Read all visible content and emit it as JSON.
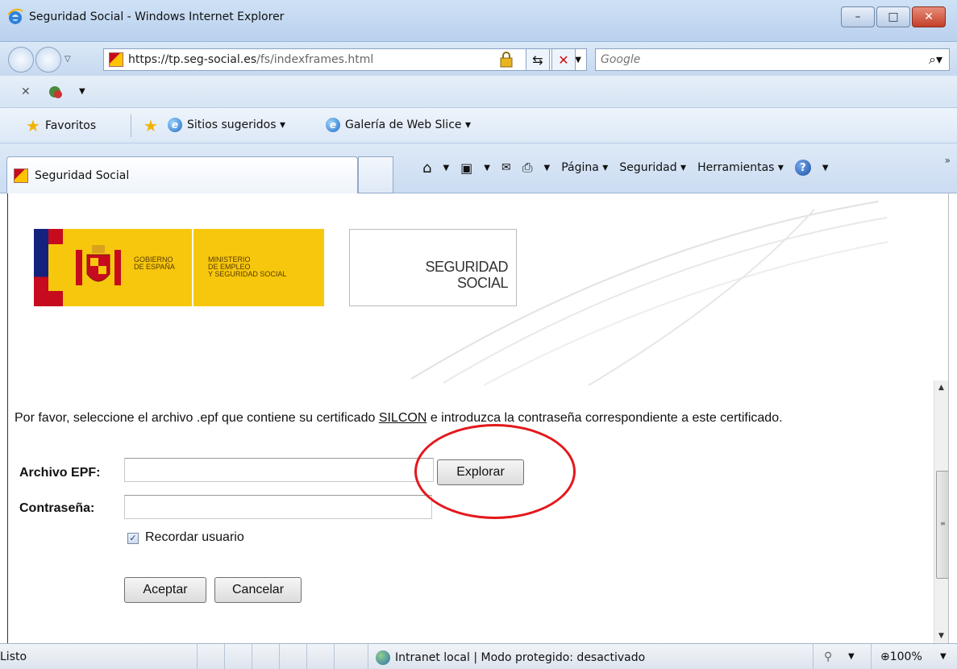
{
  "window": {
    "title": "Seguridad Social - Windows Internet Explorer",
    "minimize_glyph": "–",
    "maximize_glyph": "□",
    "close_glyph": "✕"
  },
  "address": {
    "url_host": "https://tp.seg-social.es",
    "url_path": "/fs/indexframes.html",
    "search_placeholder": "Google"
  },
  "favorites_bar": {
    "favorites_label": "Favoritos",
    "suggested_label": "Sitios sugeridos ▾",
    "webslice_label": "Galería de Web Slice ▾"
  },
  "tab": {
    "title": "Seguridad Social"
  },
  "command_bar": {
    "page_label": "Página ▾",
    "security_label": "Seguridad ▾",
    "tools_label": "Herramientas ▾",
    "more_glyph": "»"
  },
  "page": {
    "gobierno_line1": "GOBIERNO",
    "gobierno_line2": "DE ESPAÑA",
    "ministerio_line1": "MINISTERIO",
    "ministerio_line2": "DE EMPLEO",
    "ministerio_line3": "Y SEGURIDAD SOCIAL",
    "ss_line1": "SEGURIDAD",
    "ss_line2": "SOCIAL",
    "intro_before": "Por favor, seleccione el archivo .epf que contiene su certificado ",
    "intro_link": "SILCON",
    "intro_after": " e introduzca la contraseña correspondiente a este certificado.",
    "epf_label": "Archivo EPF:",
    "password_label": "Contraseña:",
    "browse_button": "Explorar",
    "remember_label": "Recordar usuario",
    "remember_checked": true,
    "accept_button": "Aceptar",
    "cancel_button": "Cancelar"
  },
  "status": {
    "text": "Listo",
    "zone": "Intranet local | Modo protegido: desactivado",
    "zoom": "100%"
  },
  "colors": {
    "annotation_circle": "#e3181c",
    "flag_red": "#c60b1e",
    "flag_yellow": "#f6c70d"
  }
}
